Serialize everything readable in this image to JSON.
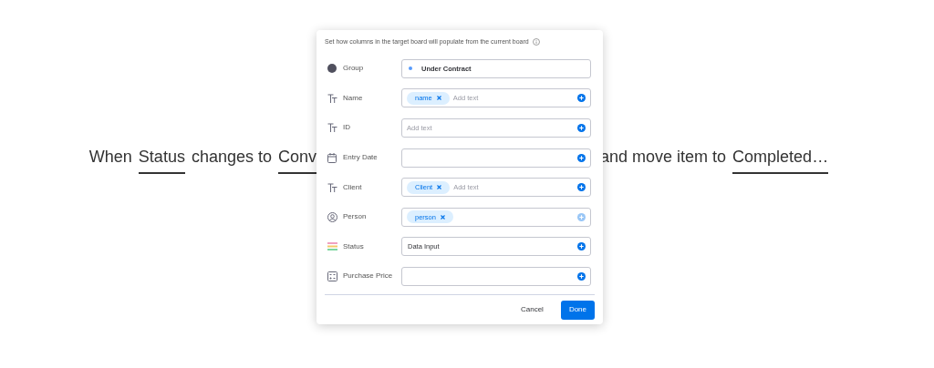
{
  "sentence_left": [
    {
      "text": "When",
      "underlined": false
    },
    {
      "text": "Status",
      "underlined": true
    },
    {
      "text": "changes to",
      "underlined": false
    },
    {
      "text": "Conv",
      "underlined": true
    }
  ],
  "sentence_right": [
    {
      "text": "and move item to",
      "underlined": false
    },
    {
      "text": "Completed…",
      "underlined": true
    }
  ],
  "dialog": {
    "hint": "Set how columns in the target board will populate from the current board",
    "rows": [
      {
        "kind": "group",
        "label": "Group",
        "value": "Under Contract"
      },
      {
        "kind": "text",
        "label": "Name",
        "chips": [
          "name"
        ],
        "placeholder": "Add text",
        "add_disabled": false
      },
      {
        "kind": "text",
        "label": "ID",
        "placeholder": "Add text",
        "add_disabled": false
      },
      {
        "kind": "date",
        "label": "Entry Date",
        "add_disabled": false
      },
      {
        "kind": "text",
        "label": "Client",
        "chips": [
          "Client"
        ],
        "placeholder": "Add text",
        "add_disabled": false
      },
      {
        "kind": "person",
        "label": "Person",
        "chips": [
          "person"
        ],
        "add_disabled": true
      },
      {
        "kind": "status",
        "label": "Status",
        "value": "Data Input",
        "add_disabled": false
      },
      {
        "kind": "numbers",
        "label": "Purchase Price",
        "add_disabled": false
      }
    ],
    "buttons": [
      {
        "label": "Cancel",
        "kind": "secondary"
      },
      {
        "label": "Done",
        "kind": "primary"
      }
    ]
  }
}
